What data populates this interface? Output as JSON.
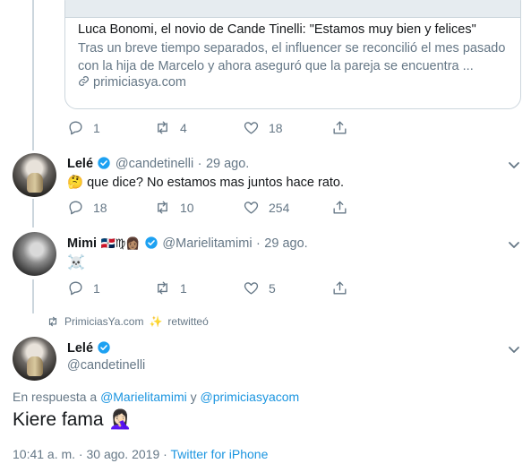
{
  "card": {
    "title": "Luca Bonomi, el novio de Cande Tinelli: \"Estamos muy bien y felices\"",
    "description": "Tras un breve tiempo separados, el influencer se reconcilió el mes pasado con la hija de Marcelo y ahora aseguró que la pareja se encuentra ...",
    "domain": "primiciasya.com"
  },
  "tweet1_actions": {
    "reply": "1",
    "retweet": "4",
    "like": "18"
  },
  "reply1": {
    "name": "Lelé",
    "handle": "@candetinelli",
    "sep": "·",
    "date": "29 ago.",
    "emoji": "🤔",
    "text": "que dice? No estamos mas juntos hace rato.",
    "actions": {
      "reply": "18",
      "retweet": "10",
      "like": "254"
    }
  },
  "reply2": {
    "name": "Mimi",
    "name_emoji": "🇩🇴♍👩🏽",
    "handle": "@Marielitamimi",
    "sep": "·",
    "date": "29 ago.",
    "text": "☠️",
    "actions": {
      "reply": "1",
      "retweet": "1",
      "like": "5"
    }
  },
  "retweet_bar": {
    "user": "PrimiciasYa.com",
    "emoji": "✨",
    "label": "retwitteó"
  },
  "main": {
    "name": "Lelé",
    "handle": "@candetinelli",
    "reply_prefix": "En respuesta a",
    "reply_user1": "@Marielitamimi",
    "reply_and": "y",
    "reply_user2": "@primiciasyacom",
    "text": "Kiere fama",
    "text_emoji": "🤦🏻‍♀️",
    "time": "10:41 a. m. · 30 ago. 2019",
    "sep": "·",
    "source": "Twitter for iPhone"
  },
  "colors": {
    "link": "#1b95e0",
    "verified": "#1da1f2",
    "muted": "#657786",
    "text": "#14171a",
    "line": "#ccd6dd"
  }
}
